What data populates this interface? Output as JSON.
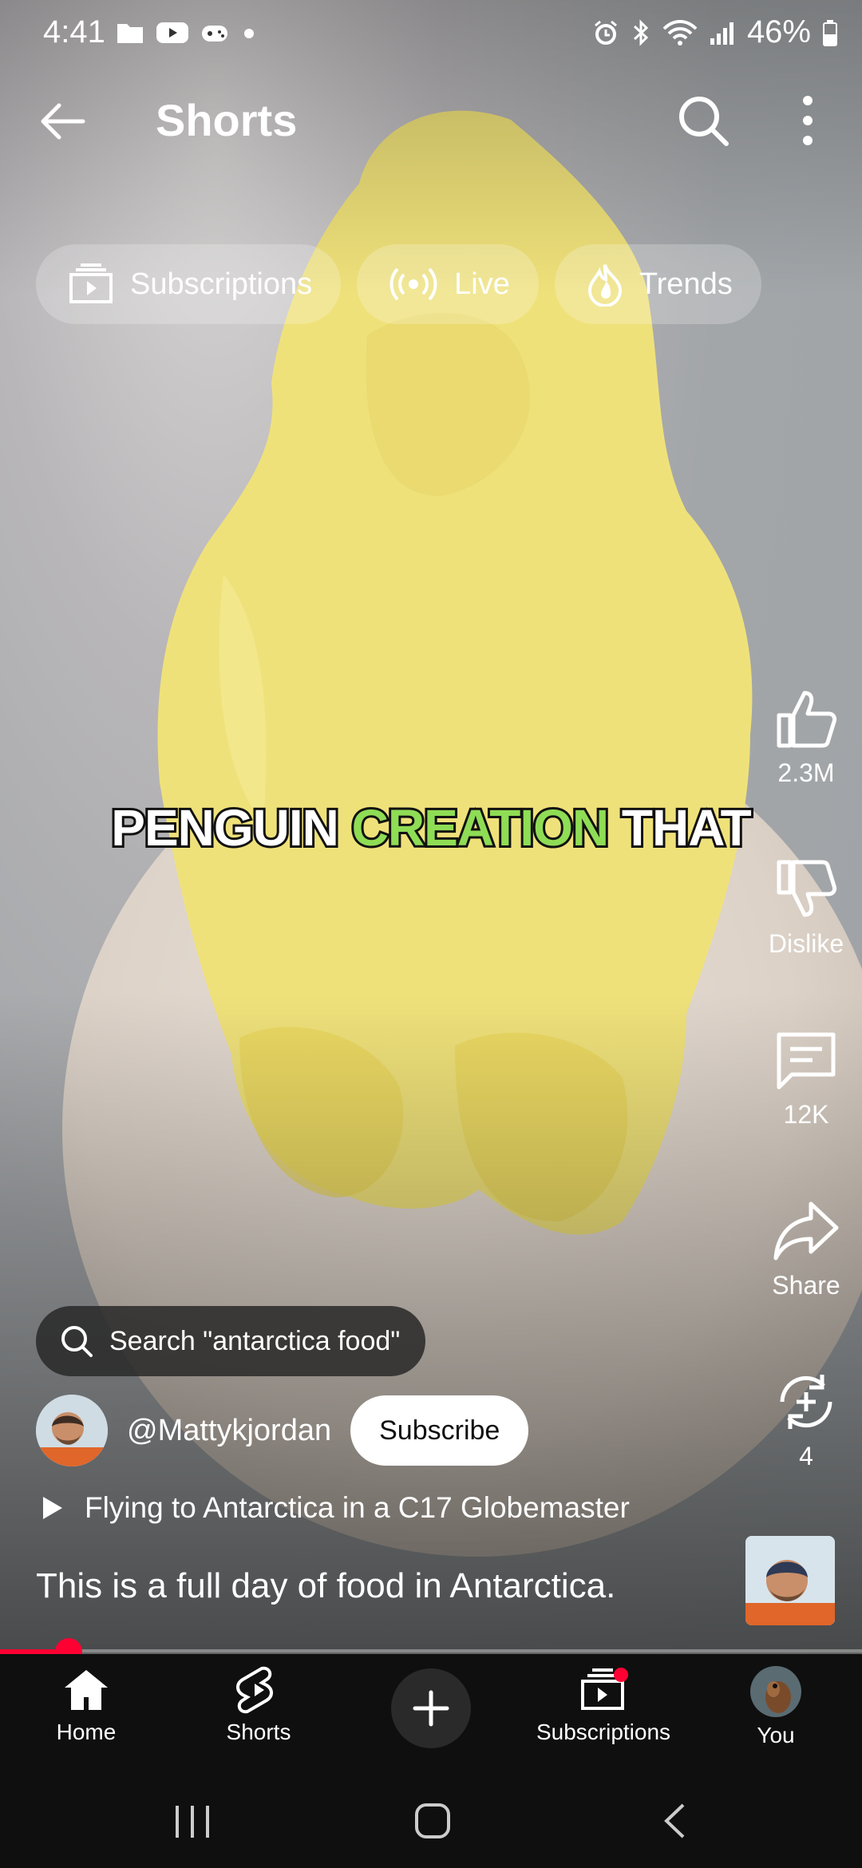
{
  "status_bar": {
    "time": "4:41",
    "battery": "46%"
  },
  "header": {
    "title": "Shorts"
  },
  "chips": [
    {
      "label": "Subscriptions",
      "icon": "subscriptions-icon"
    },
    {
      "label": "Live",
      "icon": "live-icon"
    },
    {
      "label": "Trends",
      "icon": "trends-icon"
    }
  ],
  "caption": {
    "word1": "PENGUIN",
    "word2": "CREATION",
    "word3": "THAT"
  },
  "rail": {
    "like_count": "2.3M",
    "dislike_label": "Dislike",
    "comment_count": "12K",
    "share_label": "Share",
    "remix_count": "4"
  },
  "search_suggestion": "Search \"antarctica food\"",
  "channel": {
    "handle": "@Mattykjordan",
    "subscribe_label": "Subscribe"
  },
  "playlist_title": "Flying to Antarctica in a C17 Globemaster",
  "description": "This is a full day of food in Antarctica.",
  "progress": {
    "fraction": 0.08
  },
  "bottom_nav": {
    "home": "Home",
    "shorts": "Shorts",
    "subscriptions": "Subscriptions",
    "you": "You"
  },
  "colors": {
    "accent": "#ff0033",
    "caption_highlight": "#8fdc55"
  }
}
